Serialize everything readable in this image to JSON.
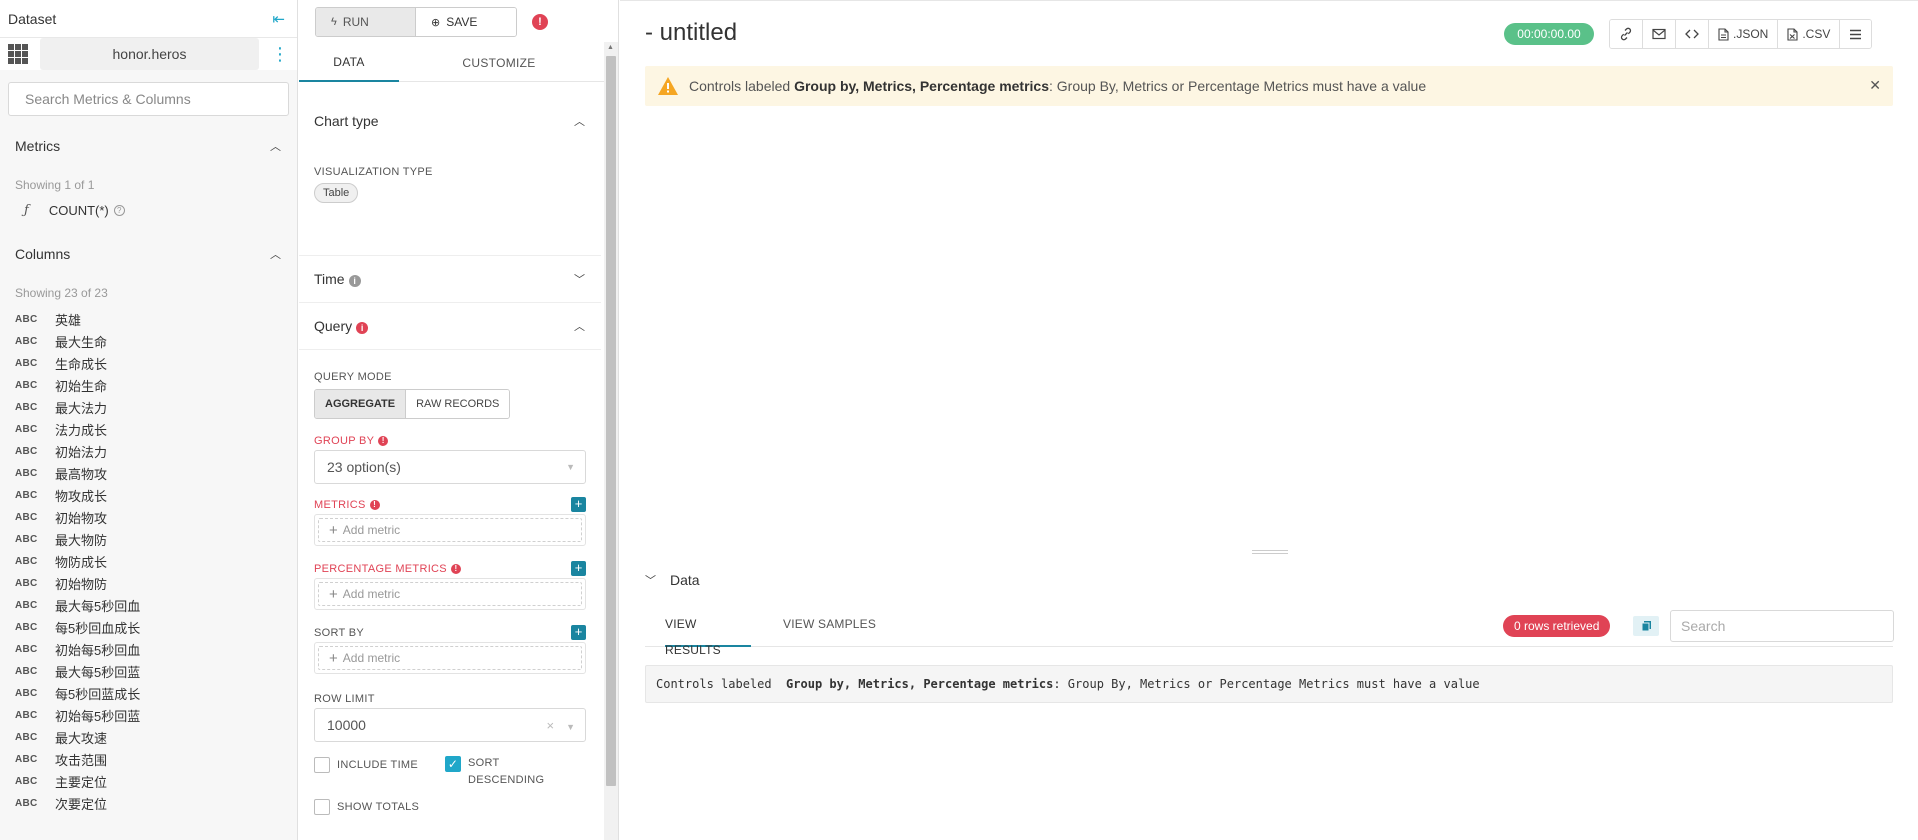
{
  "dataset": {
    "header": "Dataset",
    "name": "honor.heros",
    "search_placeholder": "Search Metrics & Columns",
    "metrics_title": "Metrics",
    "metrics_count": "Showing 1 of 1",
    "metrics": [
      {
        "name": "COUNT(*)"
      }
    ],
    "columns_title": "Columns",
    "columns_count": "Showing 23 of 23",
    "column_type": "ABC",
    "columns": [
      "英雄",
      "最大生命",
      "生命成长",
      "初始生命",
      "最大法力",
      "法力成长",
      "初始法力",
      "最高物攻",
      "物攻成长",
      "初始物攻",
      "最大物防",
      "物防成长",
      "初始物防",
      "最大每5秒回血",
      "每5秒回血成长",
      "初始每5秒回血",
      "最大每5秒回蓝",
      "每5秒回蓝成长",
      "初始每5秒回蓝",
      "最大攻速",
      "攻击范围",
      "主要定位",
      "次要定位"
    ]
  },
  "controls": {
    "run_label": "RUN",
    "save_label": "SAVE",
    "tabs": [
      "DATA",
      "CUSTOMIZE"
    ],
    "chart_type_title": "Chart type",
    "viz_type_label": "VISUALIZATION TYPE",
    "viz_type_value": "Table",
    "time_title": "Time",
    "query_title": "Query",
    "query_mode_label": "QUERY MODE",
    "query_modes": [
      "AGGREGATE",
      "RAW RECORDS"
    ],
    "group_by_label": "GROUP BY",
    "group_by_value": "23 option(s)",
    "metrics_label": "METRICS",
    "add_metric": "Add metric",
    "percentage_metrics_label": "PERCENTAGE METRICS",
    "sort_by_label": "SORT BY",
    "row_limit_label": "ROW LIMIT",
    "row_limit_value": "10000",
    "include_time_label": "INCLUDE TIME",
    "sort_descending_label_1": "SORT",
    "sort_descending_label_2": "DESCENDING",
    "show_totals_label": "SHOW TOTALS"
  },
  "main": {
    "title": "- untitled",
    "timer": "00:00:00.00",
    "json_label": ".JSON",
    "csv_label": ".CSV",
    "alert": {
      "prefix": "Controls labeled ",
      "bold": "Group by, Metrics, Percentage metrics",
      "suffix": ": Group By, Metrics or Percentage Metrics must have a value"
    },
    "data_title": "Data",
    "result_tabs": [
      "VIEW RESULTS",
      "VIEW SAMPLES"
    ],
    "rows_badge": "0 rows retrieved",
    "search_placeholder": "Search",
    "result_message": {
      "prefix": "Controls labeled  ",
      "bold": "Group by, Metrics, Percentage metrics",
      "suffix": ": Group By, Metrics or Percentage Metrics must have a value"
    }
  },
  "colors": {
    "accent": "#20a7c9",
    "error": "#e04355",
    "success": "#5ac189",
    "warning_bg": "#fdf6e3"
  }
}
